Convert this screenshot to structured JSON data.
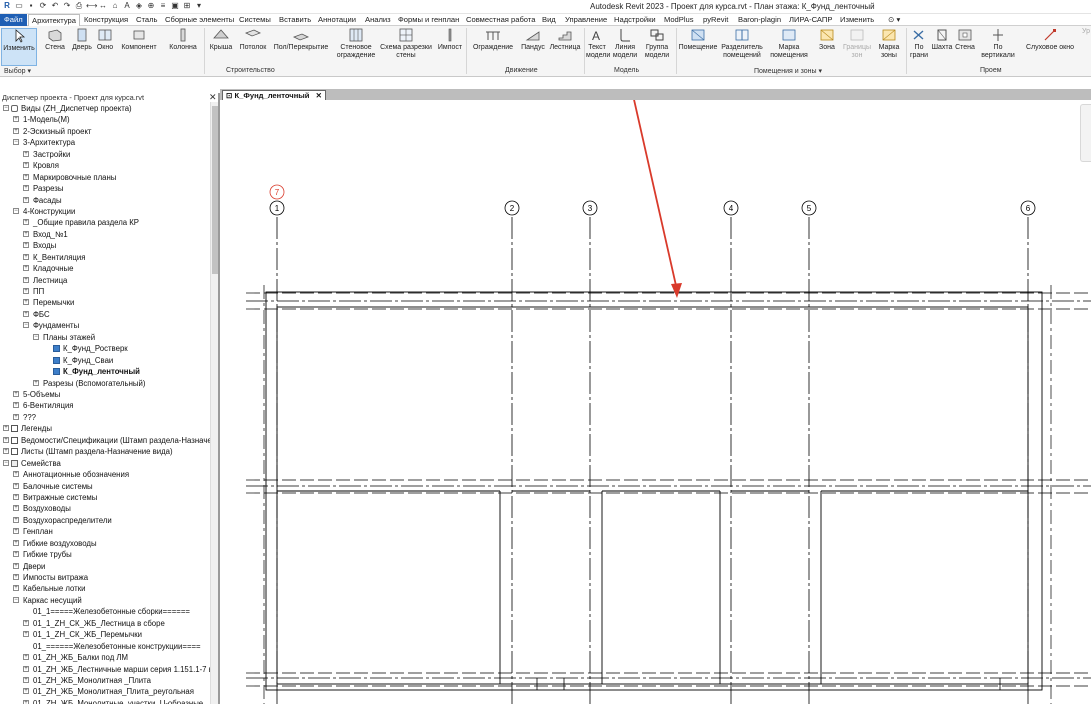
{
  "app": {
    "window_title": "Autodesk Revit 2023 - Проект для курса.rvt - План этажа: К_Фунд_ленточный"
  },
  "menu": {
    "tabs": [
      "Файл",
      "Архитектура",
      "Конструкция",
      "Сталь",
      "Сборные элементы",
      "Системы",
      "Вставить",
      "Аннотации",
      "Анализ",
      "Формы и генплан",
      "Совместная работа",
      "Вид",
      "Управление",
      "Надстройки",
      "ModPlus",
      "pyRevit",
      "Baron-plagin",
      "ЛИРА-САПР",
      "Изменить"
    ],
    "active_tab": "Архитектура"
  },
  "ribbon": {
    "buttons": [
      "Изменить",
      "Стена",
      "Дверь",
      "Окно",
      "Компонент",
      "Колонна",
      "Крыша",
      "Потолок",
      "Пол/Перекрытие",
      "Стеновое ограждение",
      "Схема разрезки стены",
      "Импост",
      "Ограждение",
      "Пандус",
      "Лестница",
      "Текст модели",
      "Линия модели",
      "Группа модели",
      "Помещение",
      "Разделитель помещений",
      "Марка помещения",
      "Зона",
      "Границы зон",
      "Марка зоны",
      "По грани",
      "Шахта",
      "Стена",
      "По вертикали",
      "Слуховое окно",
      "Ур"
    ],
    "groups": [
      "Выбор",
      "Строительство",
      "Движение",
      "Модель",
      "Помещения и зоны",
      "Проем"
    ]
  },
  "project_browser": {
    "title": "Диспетчер проекта - Проект для курса.rvt",
    "items": [
      {
        "label": "Виды (ZH_Диспетчер проекта)",
        "level": 0,
        "state": "-",
        "icon": "views"
      },
      {
        "label": "1-Модель(М)",
        "level": 1,
        "state": "+"
      },
      {
        "label": "2-Эскизный проект",
        "level": 1,
        "state": "+"
      },
      {
        "label": "3-Архитектура",
        "level": 1,
        "state": "-"
      },
      {
        "label": "Застройки",
        "level": 2,
        "state": "+"
      },
      {
        "label": "Кровля",
        "level": 2,
        "state": "+"
      },
      {
        "label": "Маркировочные планы",
        "level": 2,
        "state": "+"
      },
      {
        "label": "Разрезы",
        "level": 2,
        "state": "+"
      },
      {
        "label": "Фасады",
        "level": 2,
        "state": "+"
      },
      {
        "label": "4-Конструкции",
        "level": 1,
        "state": "-"
      },
      {
        "label": "_Общие правила раздела КР",
        "level": 2,
        "state": "+"
      },
      {
        "label": "Вход_№1",
        "level": 2,
        "state": "+"
      },
      {
        "label": "Входы",
        "level": 2,
        "state": "+"
      },
      {
        "label": "К_Вентиляция",
        "level": 2,
        "state": "+"
      },
      {
        "label": "Кладочные",
        "level": 2,
        "state": "+"
      },
      {
        "label": "Лестница",
        "level": 2,
        "state": "+"
      },
      {
        "label": "ПП",
        "level": 2,
        "state": "+"
      },
      {
        "label": "Перемычки",
        "level": 2,
        "state": "+"
      },
      {
        "label": "ФБС",
        "level": 2,
        "state": "+"
      },
      {
        "label": "Фундаменты",
        "level": 2,
        "state": "-"
      },
      {
        "label": "Планы этажей",
        "level": 3,
        "state": "-"
      },
      {
        "label": "К_Фунд_Ростверк",
        "level": 4,
        "state": "",
        "icon": "plan"
      },
      {
        "label": "К_Фунд_Сваи",
        "level": 4,
        "state": "",
        "icon": "plan"
      },
      {
        "label": "К_Фунд_ленточный",
        "level": 4,
        "state": "",
        "icon": "plan",
        "selected": true
      },
      {
        "label": "Разрезы (Вспомогательный)",
        "level": 3,
        "state": "+"
      },
      {
        "label": "5-Объемы",
        "level": 1,
        "state": "+"
      },
      {
        "label": "6-Вентиляция",
        "level": 1,
        "state": "+"
      },
      {
        "label": "???",
        "level": 1,
        "state": "+"
      },
      {
        "label": "Легенды",
        "level": 0,
        "state": "+",
        "icon": "sheet"
      },
      {
        "label": "Ведомости/Спецификации (Штамп раздела-Назначе",
        "level": 0,
        "state": "+",
        "icon": "sheet"
      },
      {
        "label": "Листы (Штамп раздела-Назначение вида)",
        "level": 0,
        "state": "+",
        "icon": "sheet"
      },
      {
        "label": "Семейства",
        "level": 0,
        "state": "-",
        "icon": "fam"
      },
      {
        "label": "Аннотационные обозначения",
        "level": 1,
        "state": "+"
      },
      {
        "label": "Балочные системы",
        "level": 1,
        "state": "+"
      },
      {
        "label": "Витражные системы",
        "level": 1,
        "state": "+"
      },
      {
        "label": "Воздуховоды",
        "level": 1,
        "state": "+"
      },
      {
        "label": "Воздухораспределители",
        "level": 1,
        "state": "+"
      },
      {
        "label": "Генплан",
        "level": 1,
        "state": "+"
      },
      {
        "label": "Гибкие воздуховоды",
        "level": 1,
        "state": "+"
      },
      {
        "label": "Гибкие трубы",
        "level": 1,
        "state": "+"
      },
      {
        "label": "Двери",
        "level": 1,
        "state": "+"
      },
      {
        "label": "Импосты витража",
        "level": 1,
        "state": "+"
      },
      {
        "label": "Кабельные лотки",
        "level": 1,
        "state": "+"
      },
      {
        "label": "Каркас несущий",
        "level": 1,
        "state": "-"
      },
      {
        "label": "01_1=====Железобетонные сборки======",
        "level": 2,
        "state": ""
      },
      {
        "label": "01_1_ZH_СК_ЖБ_Лестница в сборе",
        "level": 2,
        "state": "+"
      },
      {
        "label": "01_1_ZH_СК_ЖБ_Перемычки",
        "level": 2,
        "state": "+"
      },
      {
        "label": "01_======Железобетонные конструкции====",
        "level": 2,
        "state": ""
      },
      {
        "label": "01_ZH_ЖБ_Балки под ЛМ",
        "level": 2,
        "state": "+"
      },
      {
        "label": "01_ZH_ЖБ_Лестничные марши серия 1.151.1-7 в",
        "level": 2,
        "state": "+"
      },
      {
        "label": "01_ZH_ЖБ_Монолитная _Плита",
        "level": 2,
        "state": "+"
      },
      {
        "label": "01_ZH_ЖБ_Монолитная_Плита_реугольная",
        "level": 2,
        "state": "+"
      },
      {
        "label": "01_ZH_ЖБ_Монолитные_участки_U-образные",
        "level": 2,
        "state": "+"
      }
    ]
  },
  "view_tab": {
    "label": "К_Фунд_ленточный"
  },
  "drawing": {
    "gridlines": [
      "1",
      "2",
      "3",
      "4",
      "5",
      "6"
    ],
    "highlight_marker": "7",
    "annotation_color": "#d93a2b",
    "line_color": "#000000"
  }
}
